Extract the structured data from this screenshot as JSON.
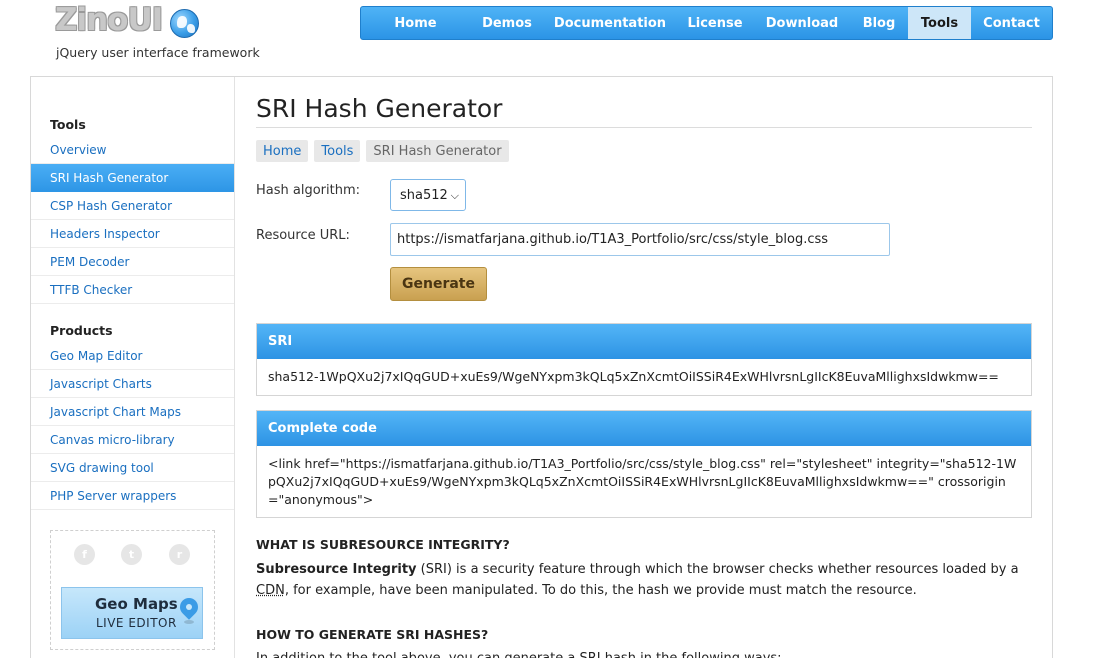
{
  "header": {
    "logo_text": "ZinoUI",
    "tagline": "jQuery user interface framework",
    "nav": [
      {
        "label": "Home",
        "active": false
      },
      {
        "label": "Demos",
        "active": false
      },
      {
        "label": "Documentation",
        "active": false
      },
      {
        "label": "License",
        "active": false
      },
      {
        "label": "Download",
        "active": false
      },
      {
        "label": "Blog",
        "active": false
      },
      {
        "label": "Tools",
        "active": true
      },
      {
        "label": "Contact",
        "active": false
      }
    ]
  },
  "sidebar": {
    "tools_title": "Tools",
    "tools": [
      {
        "label": "Overview"
      },
      {
        "label": "SRI Hash Generator",
        "active": true
      },
      {
        "label": "CSP Hash Generator"
      },
      {
        "label": "Headers Inspector"
      },
      {
        "label": "PEM Decoder"
      },
      {
        "label": "TTFB Checker"
      }
    ],
    "products_title": "Products",
    "products": [
      {
        "label": "Geo Map Editor"
      },
      {
        "label": "Javascript Charts"
      },
      {
        "label": "Javascript Chart Maps"
      },
      {
        "label": "Canvas micro-library"
      },
      {
        "label": "SVG drawing tool"
      },
      {
        "label": "PHP Server wrappers"
      }
    ],
    "social": [
      "facebook-icon",
      "twitter-icon",
      "rss-icon"
    ],
    "banner": {
      "title": "Geo Maps",
      "subtitle": "LIVE EDITOR"
    }
  },
  "main": {
    "title": "SRI Hash Generator",
    "breadcrumbs": [
      {
        "label": "Home"
      },
      {
        "label": "Tools"
      },
      {
        "label": "SRI Hash Generator",
        "current": true
      }
    ],
    "form": {
      "algorithm_label": "Hash algorithm:",
      "algorithm_value": "sha512",
      "url_label": "Resource URL:",
      "url_value": "https://ismatfarjana.github.io/T1A3_Portfolio/src/css/style_blog.css",
      "generate_label": "Generate"
    },
    "sri_panel": {
      "title": "SRI",
      "value": "sha512-1WpQXu2j7xIQqGUD+xuEs9/WgeNYxpm3kQLq5xZnXcmtOiISSiR4ExWHlvrsnLgIIcK8EuvaMllighxsIdwkmw=="
    },
    "code_panel": {
      "title": "Complete code",
      "value": "<link href=\"https://ismatfarjana.github.io/T1A3_Portfolio/src/css/style_blog.css\" rel=\"stylesheet\" integrity=\"sha512-1WpQXu2j7xIQqGUD+xuEs9/WgeNYxpm3kQLq5xZnXcmtOiISSiR4ExWHlvrsnLgIIcK8EuvaMllighxsIdwkmw==\" crossorigin=\"anonymous\">"
    },
    "section1": {
      "heading": "WHAT IS SUBRESOURCE INTEGRITY?",
      "bold": "Subresource Integrity",
      "text_a": " (SRI) is a security feature through which the browser checks whether resources loaded by a ",
      "abbr": "CDN",
      "text_b": ", for example, have been manipulated. To do this, the hash we provide must match the resource."
    },
    "section2": {
      "heading": "HOW TO GENERATE SRI HASHES?",
      "text": "In addition to the tool above, you can generate a SRI hash in the following ways:"
    },
    "colors": {
      "nav_blue": "#2b94e6",
      "link_blue": "#1a6fc0",
      "button_gold": "#c9a050"
    }
  }
}
